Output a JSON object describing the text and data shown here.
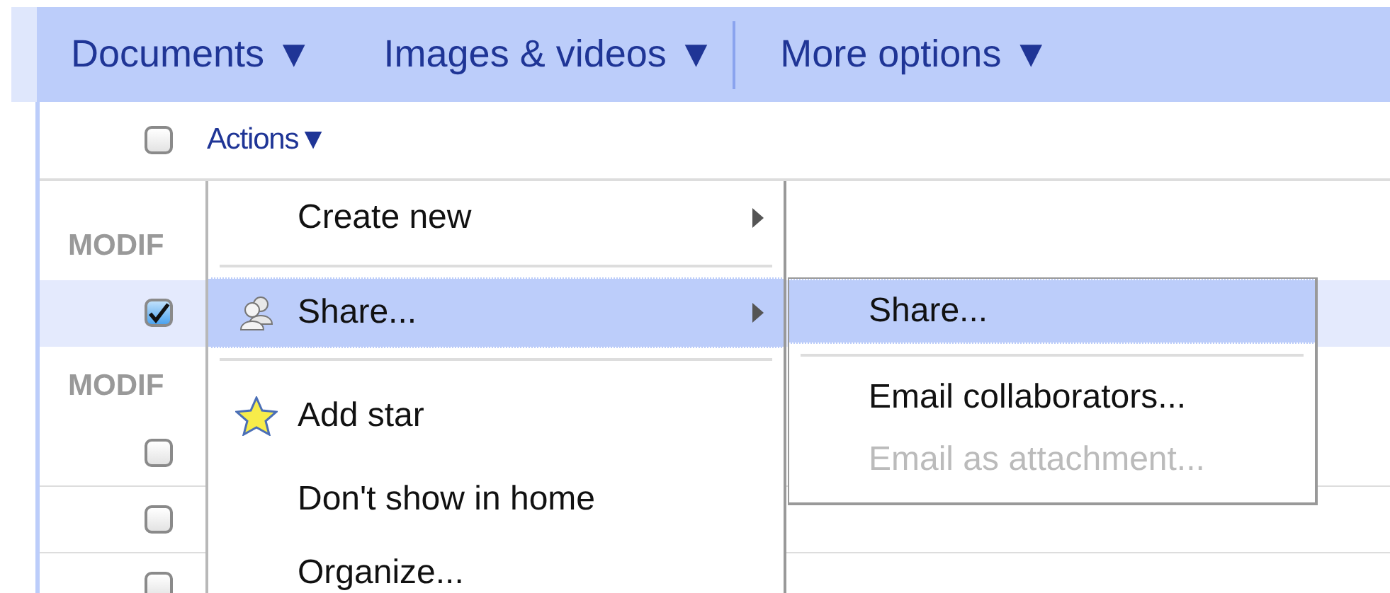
{
  "toolbar": {
    "menus": [
      {
        "kind": "menu",
        "label": "Documents",
        "arrow": "▼"
      },
      {
        "kind": "menu",
        "label": "Images & videos",
        "arrow": "▼"
      },
      {
        "kind": "divider"
      },
      {
        "kind": "menu",
        "label": "More options",
        "arrow": "▼"
      }
    ]
  },
  "actions_bar": {
    "checked": false,
    "label": "Actions",
    "arrow": "▼"
  },
  "list": {
    "rows": [
      {
        "kind": "header",
        "label": "MODIF"
      },
      {
        "kind": "item",
        "checked": true,
        "selected": true
      },
      {
        "kind": "header",
        "label": "MODIF"
      },
      {
        "kind": "item",
        "checked": false,
        "selected": false
      },
      {
        "kind": "item",
        "checked": false,
        "selected": false
      },
      {
        "kind": "item",
        "checked": false,
        "selected": false
      }
    ]
  },
  "menu": {
    "items": [
      {
        "kind": "item",
        "label": "Create new",
        "submenu": true,
        "selected": false
      },
      {
        "kind": "separator"
      },
      {
        "kind": "item",
        "label": "Share...",
        "submenu": true,
        "selected": true
      },
      {
        "kind": "separator"
      },
      {
        "kind": "item",
        "label": "Add star",
        "submenu": false,
        "selected": false
      },
      {
        "kind": "item",
        "label": "Don't show in home",
        "submenu": false,
        "selected": false
      },
      {
        "kind": "item",
        "label": "Organize...",
        "submenu": false,
        "selected": false
      }
    ]
  },
  "submenu": {
    "items": [
      {
        "kind": "item",
        "label": "Share...",
        "selected": true,
        "disabled": false
      },
      {
        "kind": "separator"
      },
      {
        "kind": "item",
        "label": "Email collaborators...",
        "selected": false,
        "disabled": false
      },
      {
        "kind": "item",
        "label": "Email as attachment...",
        "selected": false,
        "disabled": true
      }
    ]
  }
}
